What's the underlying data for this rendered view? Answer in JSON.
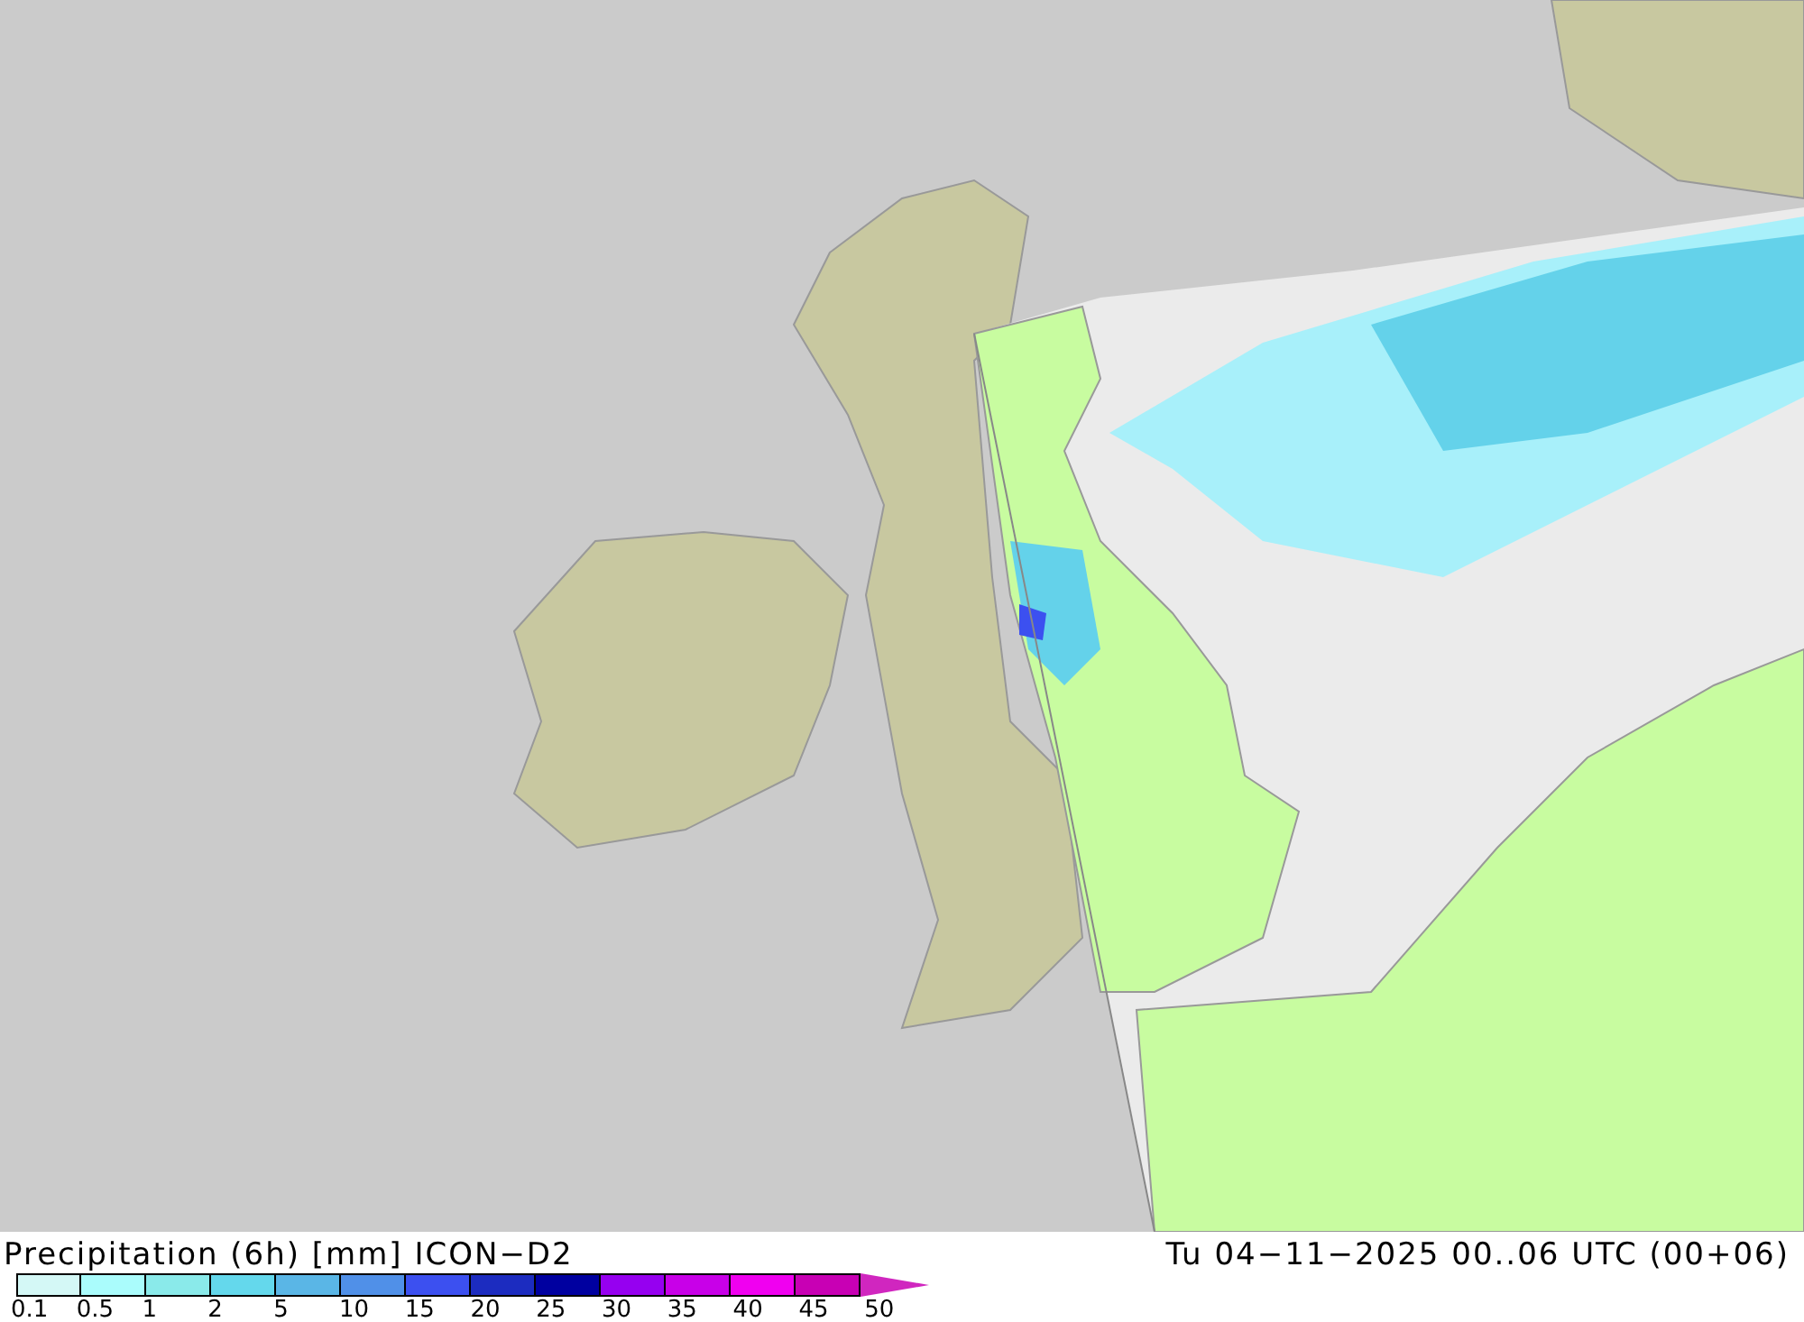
{
  "legend": {
    "title": "Precipitation (6h) [mm] ICON−D2",
    "timestamp": "Tu 04−11−2025 00..06 UTC (00+06)",
    "swatches": [
      {
        "color": "#d4f8f6"
      },
      {
        "color": "#aafcfc"
      },
      {
        "color": "#8aeaea"
      },
      {
        "color": "#64d8ec"
      },
      {
        "color": "#5ab6e6"
      },
      {
        "color": "#5090e8"
      },
      {
        "color": "#3c50f0"
      },
      {
        "color": "#1c2cc0"
      },
      {
        "color": "#0000a0"
      },
      {
        "color": "#9600f0"
      },
      {
        "color": "#c800e8"
      },
      {
        "color": "#f000f0"
      },
      {
        "color": "#c800b4"
      }
    ],
    "labels": [
      "0.1",
      "0.5",
      "1",
      "2",
      "5",
      "10",
      "15",
      "20",
      "25",
      "30",
      "35",
      "40",
      "45",
      "50"
    ]
  }
}
